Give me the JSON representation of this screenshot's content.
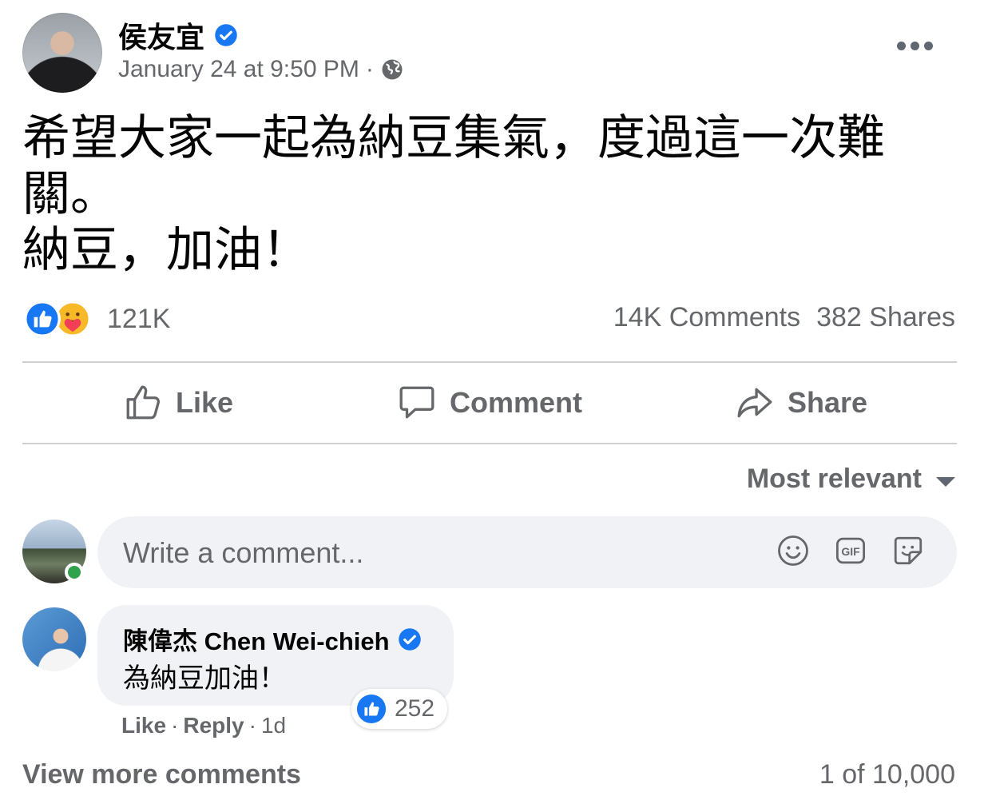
{
  "post": {
    "author": "侯友宜",
    "timestamp": "January 24 at 9:50 PM",
    "separator": "·",
    "audience_icon": "globe-icon",
    "text_lines": [
      "希望大家一起為納豆集氣，度過這一次難",
      "關。",
      "納豆，加油！"
    ]
  },
  "stats": {
    "reactions_count": "121K",
    "comments": "14K Comments",
    "shares": "382 Shares"
  },
  "actions": {
    "like": "Like",
    "comment": "Comment",
    "share": "Share"
  },
  "sort": {
    "label": "Most relevant"
  },
  "composer": {
    "placeholder": "Write a comment..."
  },
  "comment": {
    "author": "陳偉杰 Chen Wei-chieh",
    "text": "為納豆加油！",
    "likes": "252",
    "like_label": "Like",
    "reply_label": "Reply",
    "dot": "·",
    "age": "1d"
  },
  "footer": {
    "view_more": "View more comments",
    "pager": "1 of 10,000"
  },
  "colors": {
    "brand_blue": "#1877f2",
    "secondary_text": "#65676b",
    "bubble_bg": "#f0f2f5",
    "online_green": "#31a24c"
  }
}
